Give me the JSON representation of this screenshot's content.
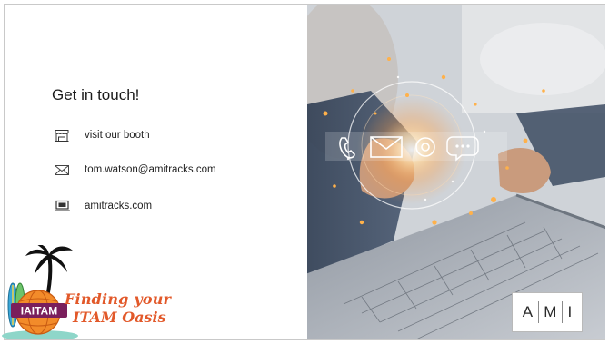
{
  "slide": {
    "title": "Get in touch!",
    "contacts": [
      {
        "icon": "booth-icon",
        "text": "visit our booth"
      },
      {
        "icon": "envelope-icon",
        "text": "tom.watson@amitracks.com"
      },
      {
        "icon": "laptop-icon",
        "text": "amitracks.com"
      }
    ]
  },
  "logo": {
    "badge_text": "IAITAM",
    "tagline_line1": "Finding your",
    "tagline_line2": "ITAM Oasis"
  },
  "brand": {
    "letters": [
      "A",
      "M",
      "I"
    ]
  },
  "colors": {
    "tagline": "#e2592a",
    "accent_glow": "#ff9a3c"
  }
}
